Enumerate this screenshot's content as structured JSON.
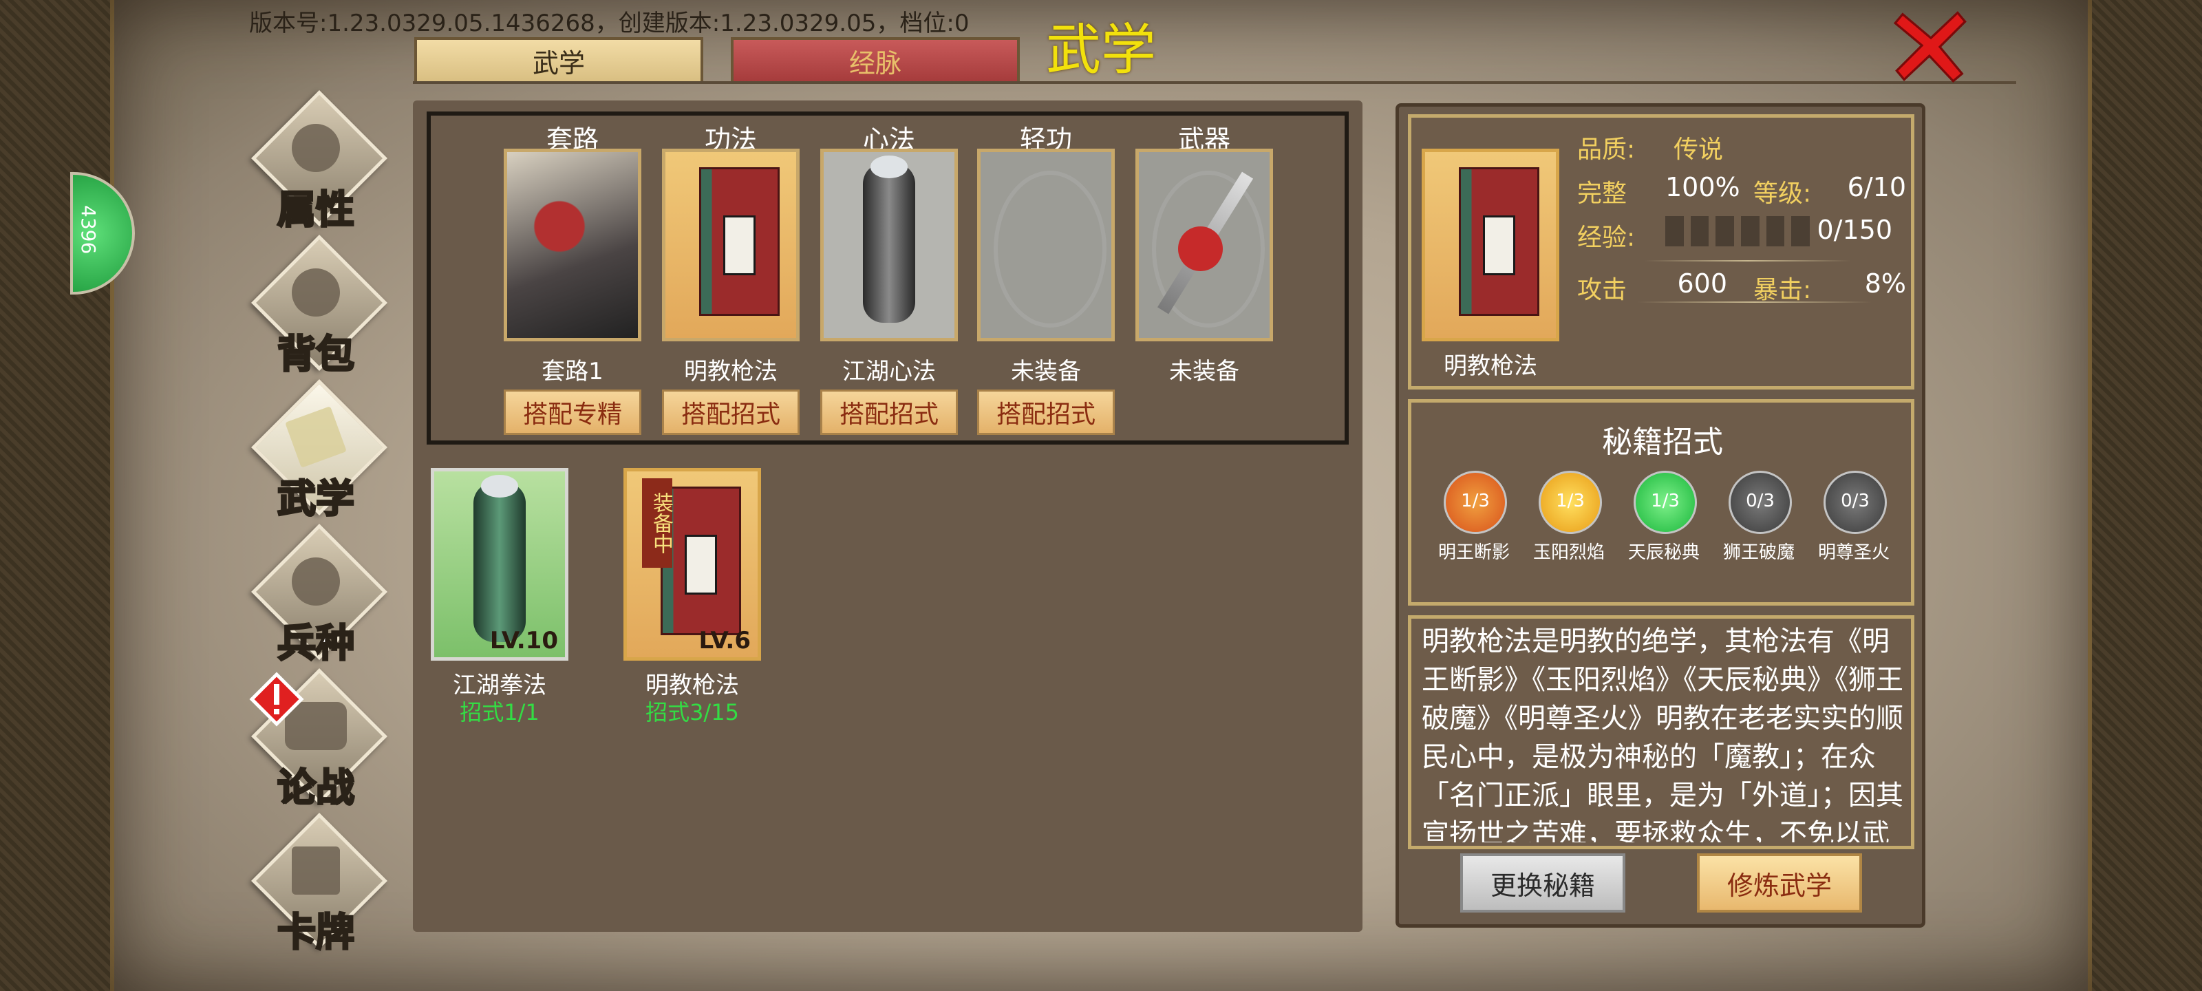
{
  "header": {
    "version": "版本号:1.23.0329.05.1436268，创建版本:1.23.0329.05，档位:0",
    "title": "武学",
    "tabs": [
      "武学",
      "经脉"
    ]
  },
  "green_tab_text": "4396",
  "sidebar": {
    "items": [
      {
        "label": "属性",
        "icon": "person-icon"
      },
      {
        "label": "背包",
        "icon": "bag-icon"
      },
      {
        "label": "武学",
        "icon": "book-icon"
      },
      {
        "label": "兵种",
        "icon": "horse-rider-icon"
      },
      {
        "label": "论战",
        "icon": "chat-bubble-icon"
      },
      {
        "label": "卡牌",
        "icon": "cards-icon"
      }
    ]
  },
  "equip": {
    "slots": [
      {
        "header": "套路",
        "name": "套路1",
        "button": "搭配专精"
      },
      {
        "header": "功法",
        "name": "明教枪法",
        "button": "搭配招式"
      },
      {
        "header": "心法",
        "name": "江湖心法",
        "button": "搭配招式"
      },
      {
        "header": "轻功",
        "name": "未装备",
        "button": "搭配招式"
      },
      {
        "header": "武器",
        "name": "未装备",
        "button": ""
      }
    ]
  },
  "inventory": [
    {
      "name": "江湖拳法",
      "level": "LV.10",
      "sub": "招式1/1"
    },
    {
      "name": "明教枪法",
      "level": "LV.6",
      "sub": "招式3/15",
      "badge": "装备中"
    }
  ],
  "detail": {
    "name": "明教枪法",
    "quality_label": "品质:",
    "quality": "传说",
    "complete_label": "完整",
    "complete": "100%",
    "level_label": "等级:",
    "level": "6/10",
    "exp_label": "经验:",
    "exp": "0/150",
    "attack_label": "攻击",
    "attack": "600",
    "crit_label": "暴击:",
    "crit": "8%"
  },
  "skills": {
    "title": "秘籍招式",
    "items": [
      {
        "name": "明王断影",
        "count": "1/3",
        "color": "#d8501a"
      },
      {
        "name": "玉阳烈焰",
        "count": "1/3",
        "color": "#e89a14"
      },
      {
        "name": "天辰秘典",
        "count": "1/3",
        "color": "#18b63a"
      },
      {
        "name": "狮王破魔",
        "count": "0/3",
        "color": "#5a5a5a"
      },
      {
        "name": "明尊圣火",
        "count": "0/3",
        "color": "#5a5a5a"
      }
    ]
  },
  "description": "明教枪法是明教的绝学，其枪法有《明王断影》《玉阳烈焰》《天辰秘典》《狮王破魔》《明尊圣火》明教在老老实实的顺民心中，是极为神秘的「魔教」；在众「名门正派」眼里，是为「外道」；因其宣扬世之苦难，要拯救众生，不免以武犯忌，不免入在",
  "buttons": {
    "replace": "更换秘籍",
    "train": "修炼武学"
  }
}
